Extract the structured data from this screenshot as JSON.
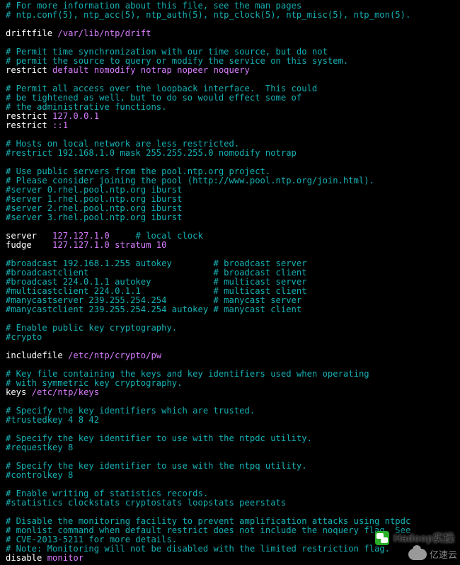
{
  "file": "ntp.conf",
  "lines": [
    {
      "kind": "comment",
      "text": "# For more information about this file, see the man pages"
    },
    {
      "kind": "comment",
      "text": "# ntp.conf(5), ntp_acc(5), ntp_auth(5), ntp_clock(5), ntp_misc(5), ntp_mon(5)."
    },
    {
      "kind": "blank"
    },
    {
      "kind": "directive",
      "directive": "driftfile",
      "value": "/var/lib/ntp/drift"
    },
    {
      "kind": "blank"
    },
    {
      "kind": "comment",
      "text": "# Permit time synchronization with our time source, but do not"
    },
    {
      "kind": "comment",
      "text": "# permit the source to query or modify the service on this system."
    },
    {
      "kind": "directive",
      "directive": "restrict",
      "value": "default nomodify notrap nopeer noquery"
    },
    {
      "kind": "blank"
    },
    {
      "kind": "comment",
      "text": "# Permit all access over the loopback interface.  This could"
    },
    {
      "kind": "comment",
      "text": "# be tightened as well, but to do so would effect some of"
    },
    {
      "kind": "comment",
      "text": "# the administrative functions."
    },
    {
      "kind": "directive",
      "directive": "restrict",
      "value": "127.0.0.1"
    },
    {
      "kind": "directive",
      "directive": "restrict",
      "value": "::1"
    },
    {
      "kind": "blank"
    },
    {
      "kind": "comment",
      "text": "# Hosts on local network are less restricted."
    },
    {
      "kind": "comment",
      "text": "#restrict 192.168.1.0 mask 255.255.255.0 nomodify notrap"
    },
    {
      "kind": "blank"
    },
    {
      "kind": "comment",
      "text": "# Use public servers from the pool.ntp.org project."
    },
    {
      "kind": "comment",
      "text": "# Please consider joining the pool (http://www.pool.ntp.org/join.html)."
    },
    {
      "kind": "comment",
      "text": "#server 0.rhel.pool.ntp.org iburst"
    },
    {
      "kind": "comment",
      "text": "#server 1.rhel.pool.ntp.org iburst"
    },
    {
      "kind": "comment",
      "text": "#server 2.rhel.pool.ntp.org iburst"
    },
    {
      "kind": "comment",
      "text": "#server 3.rhel.pool.ntp.org iburst"
    },
    {
      "kind": "blank"
    },
    {
      "kind": "directive_trail",
      "directive": "server ",
      "value": " 127.127.1.0    ",
      "trail": " # local clock"
    },
    {
      "kind": "directive",
      "directive": "fudge  ",
      "value": " 127.127.1.0 stratum 10"
    },
    {
      "kind": "blank"
    },
    {
      "kind": "comment",
      "text": "#broadcast 192.168.1.255 autokey        # broadcast server"
    },
    {
      "kind": "comment",
      "text": "#broadcastclient                        # broadcast client"
    },
    {
      "kind": "comment",
      "text": "#broadcast 224.0.1.1 autokey            # multicast server"
    },
    {
      "kind": "comment",
      "text": "#multicastclient 224.0.1.1              # multicast client"
    },
    {
      "kind": "comment",
      "text": "#manycastserver 239.255.254.254         # manycast server"
    },
    {
      "kind": "comment",
      "text": "#manycastclient 239.255.254.254 autokey # manycast client"
    },
    {
      "kind": "blank"
    },
    {
      "kind": "comment",
      "text": "# Enable public key cryptography."
    },
    {
      "kind": "comment",
      "text": "#crypto"
    },
    {
      "kind": "blank"
    },
    {
      "kind": "directive",
      "directive": "includefile",
      "value": "/etc/ntp/crypto/pw"
    },
    {
      "kind": "blank"
    },
    {
      "kind": "comment",
      "text": "# Key file containing the keys and key identifiers used when operating"
    },
    {
      "kind": "comment",
      "text": "# with symmetric key cryptography."
    },
    {
      "kind": "directive",
      "directive": "keys",
      "value": "/etc/ntp/keys"
    },
    {
      "kind": "blank"
    },
    {
      "kind": "comment",
      "text": "# Specify the key identifiers which are trusted."
    },
    {
      "kind": "comment",
      "text": "#trustedkey 4 8 42"
    },
    {
      "kind": "blank"
    },
    {
      "kind": "comment",
      "text": "# Specify the key identifier to use with the ntpdc utility."
    },
    {
      "kind": "comment",
      "text": "#requestkey 8"
    },
    {
      "kind": "blank"
    },
    {
      "kind": "comment",
      "text": "# Specify the key identifier to use with the ntpq utility."
    },
    {
      "kind": "comment",
      "text": "#controlkey 8"
    },
    {
      "kind": "blank"
    },
    {
      "kind": "comment",
      "text": "# Enable writing of statistics records."
    },
    {
      "kind": "comment",
      "text": "#statistics clockstats cryptostats loopstats peerstats"
    },
    {
      "kind": "blank"
    },
    {
      "kind": "comment",
      "text": "# Disable the monitoring facility to prevent amplification attacks using ntpdc"
    },
    {
      "kind": "comment",
      "text": "# monlist command when default restrict does not include the noquery flag. See"
    },
    {
      "kind": "comment",
      "text": "# CVE-2013-5211 for more details."
    },
    {
      "kind": "comment",
      "text": "# Note: Monitoring will not be disabled with the limited restriction flag."
    },
    {
      "kind": "directive",
      "directive": "disable",
      "value": "monitor"
    }
  ],
  "watermark": {
    "top_text": "Hadoop实操",
    "bottom_text": "亿速云"
  }
}
